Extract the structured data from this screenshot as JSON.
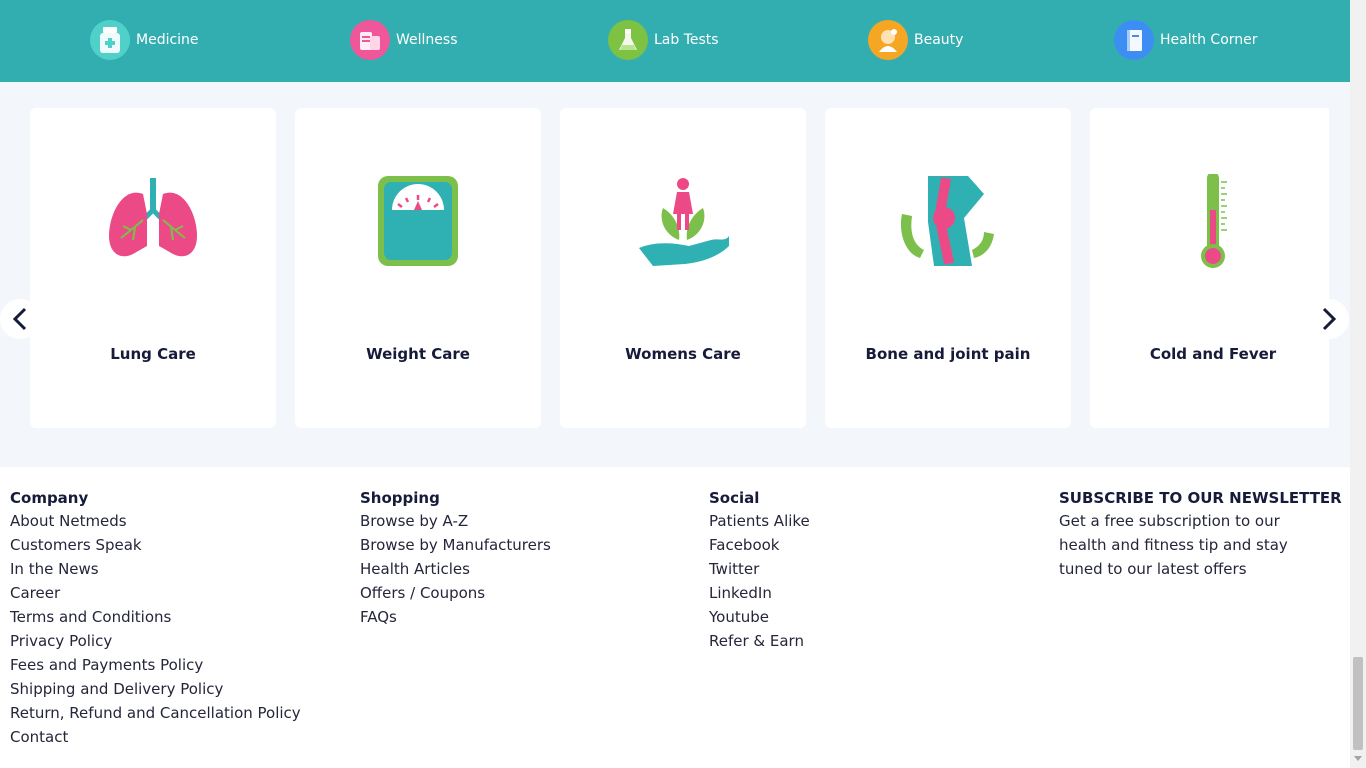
{
  "nav": {
    "items": [
      {
        "label": "Medicine",
        "icon": "medicine-bottle-icon",
        "color": "#4fd0c8"
      },
      {
        "label": "Wellness",
        "icon": "wellness-products-icon",
        "color": "#f0569a"
      },
      {
        "label": "Lab Tests",
        "icon": "lab-test-icon",
        "color": "#7dc243"
      },
      {
        "label": "Beauty",
        "icon": "beauty-icon",
        "color": "#f5a623"
      },
      {
        "label": "Health Corner",
        "icon": "health-book-icon",
        "color": "#3d8ef2"
      }
    ]
  },
  "carousel": {
    "cards": [
      {
        "title": "Lung Care",
        "icon": "lungs-icon"
      },
      {
        "title": "Weight Care",
        "icon": "weighing-scale-icon"
      },
      {
        "title": "Womens Care",
        "icon": "woman-hand-icon"
      },
      {
        "title": "Bone and joint pain",
        "icon": "knee-joint-icon"
      },
      {
        "title": "Cold and Fever",
        "icon": "thermometer-icon"
      }
    ]
  },
  "footer": {
    "company": {
      "heading": "Company",
      "links": [
        "About Netmeds",
        "Customers Speak",
        "In the News",
        "Career",
        "Terms and Conditions",
        "Privacy Policy",
        "Fees and Payments Policy",
        "Shipping and Delivery Policy",
        "Return, Refund and Cancellation Policy",
        "Contact"
      ]
    },
    "shopping": {
      "heading": "Shopping",
      "links": [
        "Browse by A-Z",
        "Browse by Manufacturers",
        "Health Articles",
        "Offers / Coupons",
        "FAQs"
      ]
    },
    "social": {
      "heading": "Social",
      "links": [
        "Patients Alike",
        "Facebook",
        "Twitter",
        "LinkedIn",
        "Youtube",
        "Refer & Earn"
      ]
    },
    "newsletter": {
      "heading": "SUBSCRIBE TO OUR NEWSLETTER",
      "text": "Get a free subscription to our health and fitness tip and stay tuned to our latest offers"
    }
  },
  "colors": {
    "nav_bg": "#32aeb1",
    "page_bg": "#f3f6fb",
    "text_dark": "#151b39"
  }
}
